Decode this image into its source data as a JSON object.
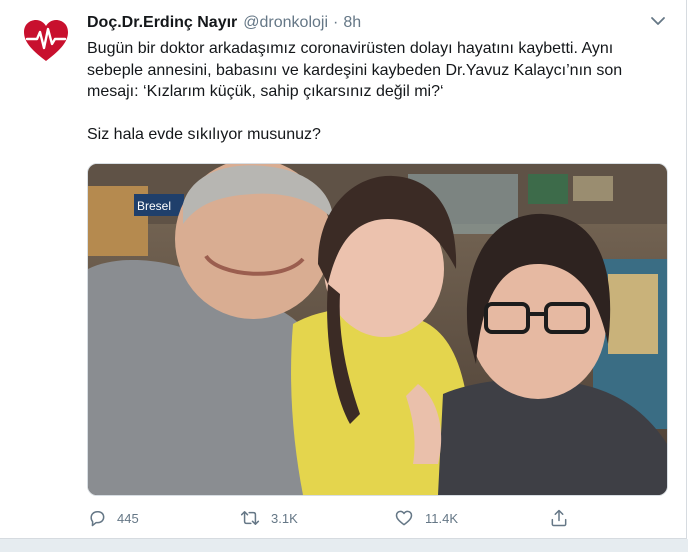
{
  "author": {
    "display_name": "Doç.Dr.Erdinç Nayır",
    "handle": "@dronkoloji",
    "separator": "·",
    "time": "8h",
    "avatar_icon": "heart-pulse-logo-icon"
  },
  "tweet": {
    "line1": "Bugün bir doktor arkadaşımız coronavirüsten dolayı hayatını kaybetti. Aynı",
    "line2": "sebeple annesini, babasını ve kardeşini kaybeden Dr.Yavuz Kalaycı’nın son",
    "line3": "mesajı: ‘Kızlarım küçük, sahip çıkarsınız değil mi?‘",
    "line4": "Siz hala evde sıkılıyor musunuz?"
  },
  "photo": {
    "description_icon": "family-photo",
    "sign_text": "Bresel"
  },
  "actions": {
    "reply_icon": "reply-icon",
    "reply_count": "445",
    "retweet_icon": "retweet-icon",
    "retweet_count": "3.1K",
    "like_icon": "heart-icon",
    "like_count": "11.4K",
    "share_icon": "share-icon"
  },
  "colors": {
    "text": "#14171a",
    "muted": "#657786",
    "avatar_red": "#c8102e",
    "border": "#e6ecf0"
  }
}
